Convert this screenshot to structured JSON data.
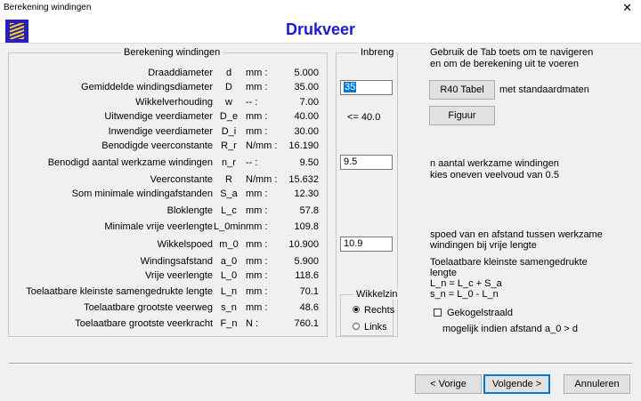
{
  "window": {
    "title": "Berekening windingen",
    "close_glyph": "✕"
  },
  "header": {
    "title": "Drukveer"
  },
  "calc_group": {
    "legend": "Berekening windingen",
    "rows": [
      {
        "label": "Draaddiameter",
        "symbol": "d",
        "unit": "mm :",
        "value": "5.000"
      },
      {
        "label": "Gemiddelde windingsdiameter",
        "symbol": "D",
        "unit": "mm :",
        "value": "35.00"
      },
      {
        "label": "Wikkelverhouding",
        "symbol": "w",
        "unit": "-- :",
        "value": "7.00"
      },
      {
        "label": "Uitwendige veerdiameter",
        "symbol": "D_e",
        "unit": "mm :",
        "value": "40.00"
      },
      {
        "label": "Inwendige veerdiameter",
        "symbol": "D_i",
        "unit": "mm :",
        "value": "30.00"
      },
      {
        "label": "Benodigde veerconstante",
        "symbol": "R_r",
        "unit": "N/mm :",
        "value": "16.190"
      },
      {
        "label": "Benodigd aantal werkzame windingen",
        "symbol": "n_r",
        "unit": "-- :",
        "value": "9.50"
      },
      {
        "label": "Veerconstante",
        "symbol": "R",
        "unit": "N/mm :",
        "value": "15.632"
      },
      {
        "label": "Som minimale windingafstanden",
        "symbol": "S_a",
        "unit": "mm :",
        "value": "12.30"
      },
      {
        "label": "Bloklengte",
        "symbol": "L_c",
        "unit": "mm :",
        "value": "57.8"
      },
      {
        "label": "Minimale vrije veerlengte",
        "symbol": "L_0min",
        "unit": "mm :",
        "value": "109.8"
      },
      {
        "label": "Wikkelspoed",
        "symbol": "m_0",
        "unit": "mm :",
        "value": "10.900"
      },
      {
        "label": "Windingsafstand",
        "symbol": "a_0",
        "unit": "mm :",
        "value": "5.900"
      },
      {
        "label": "Vrije veerlengte",
        "symbol": "L_0",
        "unit": "mm :",
        "value": "118.6"
      },
      {
        "label": "Toelaatbare kleinste samengedrukte lengte",
        "symbol": "L_n",
        "unit": "mm :",
        "value": "70.1"
      },
      {
        "label": "Toelaatbare grootste veerweg",
        "symbol": "s_n",
        "unit": "mm :",
        "value": "48.6"
      },
      {
        "label": "Toelaatbare grootste veerkracht",
        "symbol": "F_n",
        "unit": "N :",
        "value": "760.1"
      }
    ]
  },
  "input_group": {
    "legend": "Inbreng",
    "diameter_value": "35",
    "max_note": "<= 40.0",
    "windings_value": "9.5",
    "pitch_value": "10.9"
  },
  "direction_group": {
    "legend": "Wikkelzin",
    "options": [
      {
        "label": "Rechts",
        "selected": true
      },
      {
        "label": "Links",
        "selected": false
      }
    ]
  },
  "right_panel": {
    "hint_line1": "Gebruik de Tab toets om te navigeren",
    "hint_line2": "en om de berekening uit te voeren",
    "r40_button": "R40 Tabel",
    "r40_note": "met standaardmaten",
    "figure_button": "Figuur",
    "windings_note1": "n aantal werkzame windingen",
    "windings_note2": "kies oneven veelvoud van 0.5",
    "pitch_note1": "spoed van en afstand tussen werkzame",
    "pitch_note2": "windingen bij vrije lengte",
    "length_note1": "Toelaatbare kleinste samengedrukte",
    "length_note2": "lengte",
    "length_note3": "L_n = L_c + S_a",
    "length_note4": "s_n = L_0 - L_n",
    "ground_label": "Gekogelstraald",
    "ground_checked": false,
    "ground_note": "mogelijk indien afstand a_0 > d"
  },
  "footer": {
    "prev_button": "< Vorige",
    "next_button": "Volgende >",
    "cancel_button": "Annuleren"
  }
}
